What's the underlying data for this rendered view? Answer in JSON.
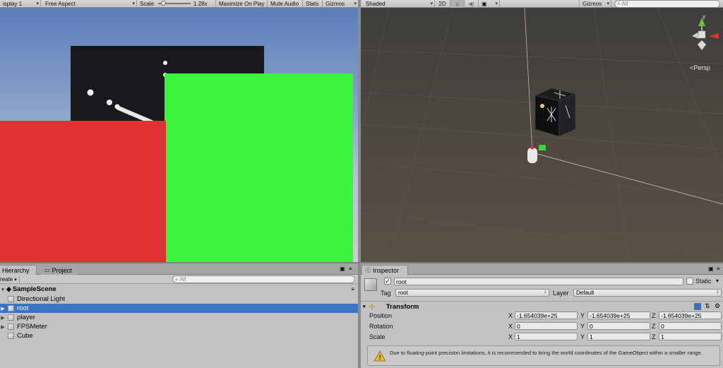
{
  "game_toolbar": {
    "display": "isplay 1",
    "aspect": "Free Aspect",
    "scale_label": "Scale",
    "scale_value": "1.28x",
    "maximize": "Maximize On Play",
    "mute": "Mute Audio",
    "stats": "Stats",
    "gizmos": "Gizmos"
  },
  "scene_toolbar": {
    "shading": "Shaded",
    "mode_2d": "2D",
    "gizmos": "Gizmos",
    "search_placeholder": "All"
  },
  "scene_view": {
    "projection": "Persp",
    "axis_y": "y"
  },
  "hierarchy": {
    "tab_label": "Hierarchy",
    "project_tab_label": "Project",
    "create_label": "reate",
    "search_placeholder": "All",
    "scene_name": "SampleScene",
    "items": [
      {
        "label": "Directional Light",
        "expandable": false
      },
      {
        "label": "root",
        "expandable": true
      },
      {
        "label": "player",
        "expandable": true
      },
      {
        "label": "FPSMeter",
        "expandable": true
      },
      {
        "label": "Cube",
        "expandable": false
      }
    ]
  },
  "inspector": {
    "tab_label": "Inspector",
    "object_name": "root",
    "static_label": "Static",
    "tag_label": "Tag",
    "tag_value": "root",
    "layer_label": "Layer",
    "layer_value": "Default",
    "component": "Transform",
    "rows": [
      {
        "label": "Position",
        "x": "-1.654039e+25",
        "y": "-1.654039e+25",
        "z": "-1.654039e+25"
      },
      {
        "label": "Rotation",
        "x": "0",
        "y": "0",
        "z": "0"
      },
      {
        "label": "Scale",
        "x": "1",
        "y": "1",
        "z": "1"
      }
    ],
    "axis_x": "X",
    "axis_y": "Y",
    "axis_z": "Z",
    "warning": "Due to floating-point precision limitations, it is recommended to bring the world coordinates of the GameObject within a smaller range."
  },
  "colors": {
    "red_quad": "#e03232",
    "green_quad": "#3df43d",
    "selection": "#3b74c7"
  }
}
